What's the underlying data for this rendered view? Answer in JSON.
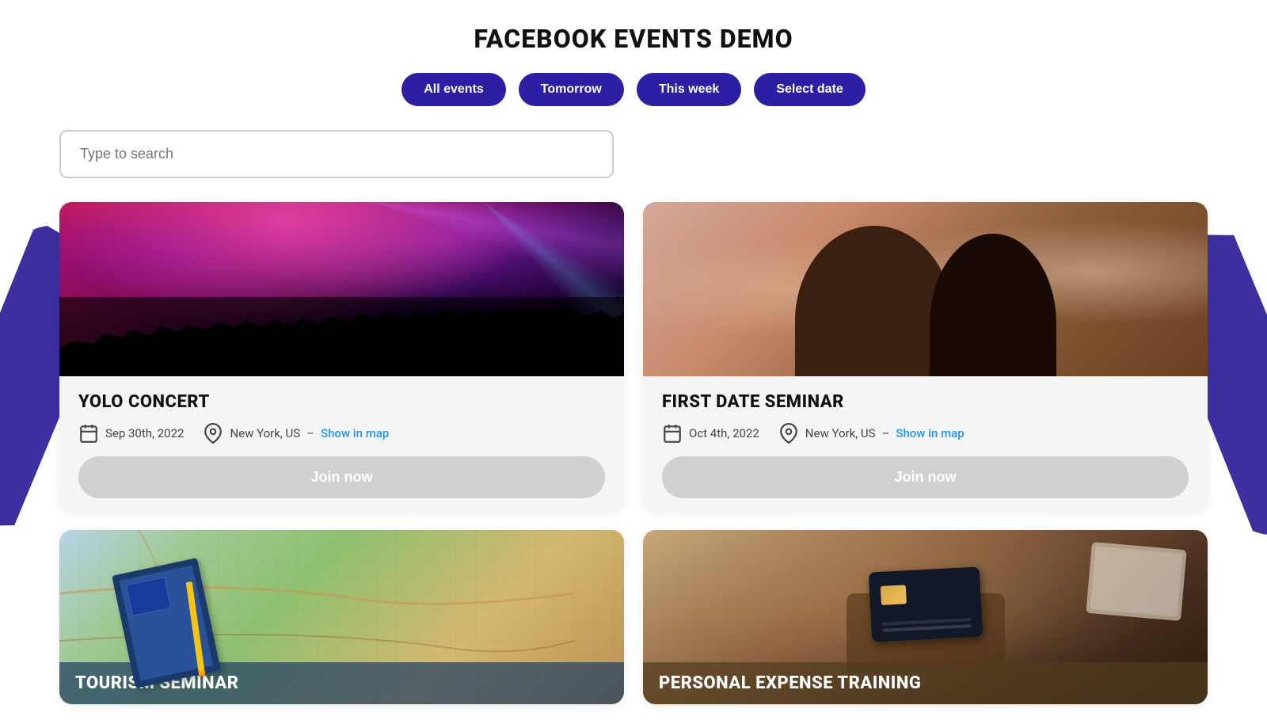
{
  "page": {
    "title": "FACEBOOK EVENTS DEMO"
  },
  "filters": {
    "all_events": "All events",
    "tomorrow": "Tomorrow",
    "this_week": "This week",
    "select_date": "Select date"
  },
  "search": {
    "placeholder": "Type to search"
  },
  "events": [
    {
      "id": "yolo-concert",
      "title": "YOLO CONCERT",
      "date": "Sep 30th, 2022",
      "location": "New York, US",
      "show_in_map": "Show in map",
      "join_label": "Join now",
      "image_type": "concert"
    },
    {
      "id": "first-date-seminar",
      "title": "FIRST DATE SEMINAR",
      "date": "Oct 4th, 2022",
      "location": "New York, US",
      "show_in_map": "Show in map",
      "join_label": "Join now",
      "image_type": "couple"
    },
    {
      "id": "tourism-seminar",
      "title": "TOURISM SEMINAR",
      "date": "",
      "location": "",
      "show_in_map": "",
      "join_label": "",
      "image_type": "tourism"
    },
    {
      "id": "personal-expense-training",
      "title": "PERSONAL EXPENSE TRAINING",
      "date": "",
      "location": "",
      "show_in_map": "",
      "join_label": "",
      "image_type": "expense"
    }
  ],
  "icons": {
    "calendar": "📅",
    "location": "📍"
  }
}
